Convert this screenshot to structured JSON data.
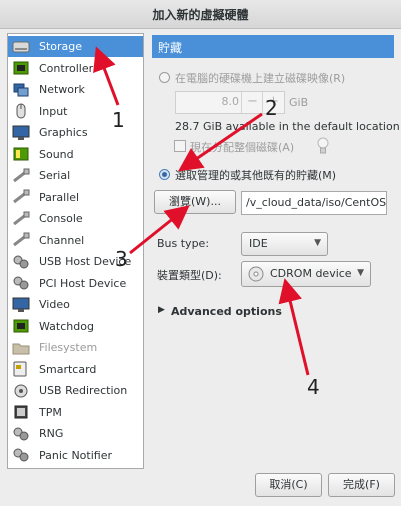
{
  "window": {
    "title": "加入新的虛擬硬體"
  },
  "sidebar": {
    "items": [
      {
        "label": "Storage",
        "icon": "hard-disk-icon",
        "selected": true
      },
      {
        "label": "Controller",
        "icon": "controller-icon"
      },
      {
        "label": "Network",
        "icon": "network-icon"
      },
      {
        "label": "Input",
        "icon": "mouse-icon"
      },
      {
        "label": "Graphics",
        "icon": "monitor-icon"
      },
      {
        "label": "Sound",
        "icon": "sound-icon"
      },
      {
        "label": "Serial",
        "icon": "serial-cable-icon"
      },
      {
        "label": "Parallel",
        "icon": "parallel-cable-icon"
      },
      {
        "label": "Console",
        "icon": "console-cable-icon"
      },
      {
        "label": "Channel",
        "icon": "channel-cable-icon"
      },
      {
        "label": "USB Host Device",
        "icon": "usb-device-icon"
      },
      {
        "label": "PCI Host Device",
        "icon": "pci-device-icon"
      },
      {
        "label": "Video",
        "icon": "video-monitor-icon"
      },
      {
        "label": "Watchdog",
        "icon": "watchdog-chip-icon"
      },
      {
        "label": "Filesystem",
        "icon": "folder-icon",
        "disabled": true
      },
      {
        "label": "Smartcard",
        "icon": "smartcard-icon"
      },
      {
        "label": "USB Redirection",
        "icon": "usb-redirection-icon"
      },
      {
        "label": "TPM",
        "icon": "tpm-chip-icon"
      },
      {
        "label": "RNG",
        "icon": "rng-icon"
      },
      {
        "label": "Panic Notifier",
        "icon": "panic-notifier-icon"
      }
    ]
  },
  "panel": {
    "header": "貯藏",
    "option_create": "在電腦的硬碟機上建立磁碟映像(R)",
    "size_value": "8.0",
    "size_minus": "−",
    "size_plus": "+",
    "size_unit": "GiB",
    "available": "28.7 GiB available in the default location",
    "allocate": "現在分配整個磁碟(A)",
    "option_existing": "選取管理的或其他既有的貯藏(M)",
    "browse_label": "瀏覽(W)...",
    "path_value": "/v_cloud_data/iso/CentOS",
    "bus_label": "Bus type:",
    "bus_value": "IDE",
    "device_label": "裝置類型(D):",
    "device_value": "CDROM device",
    "advanced": "Advanced options"
  },
  "buttons": {
    "cancel": "取消(C)",
    "finish": "完成(F)"
  },
  "annotations": {
    "n1": "1",
    "n2": "2",
    "n3": "3",
    "n4": "4"
  },
  "colors": {
    "accent": "#4a90d9",
    "arrow": "#e0102a"
  }
}
